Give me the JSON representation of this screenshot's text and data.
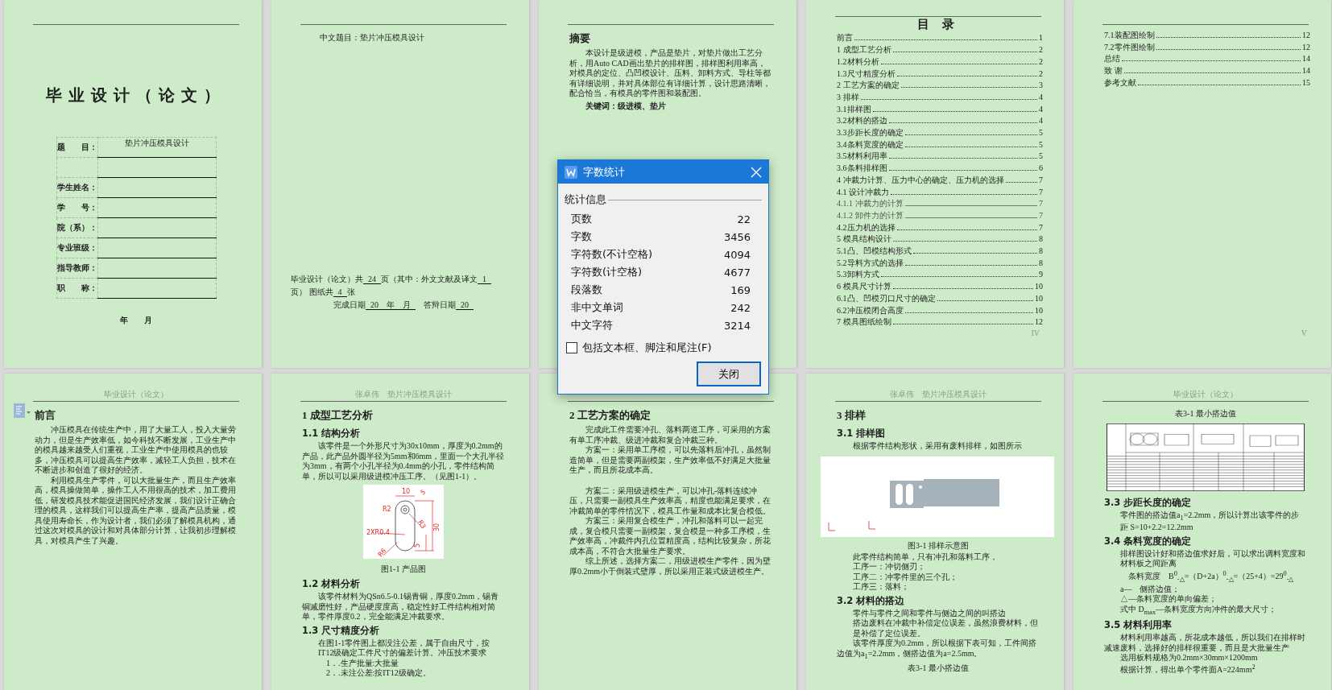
{
  "cover": {
    "title": "毕业设计（论文）",
    "fields": [
      {
        "kind": "field",
        "label": "题　　目：",
        "value": "垫片冲压模具设计"
      },
      {
        "kind": "extra_line"
      },
      {
        "kind": "field",
        "label": "学生姓名："
      },
      {
        "kind": "field",
        "label": "学　　号："
      },
      {
        "kind": "field",
        "label": "院（系）："
      },
      {
        "kind": "field",
        "label": "专业班级："
      },
      {
        "kind": "field",
        "label": "指导教师："
      },
      {
        "kind": "field",
        "label": "职　　称："
      }
    ],
    "date": "年　　月"
  },
  "info_page": {
    "title": "中文题目：垫片冲压模具设计",
    "statement": [
      {
        "kind": "text",
        "text": "毕业设计（论文）共"
      },
      {
        "kind": "blank",
        "text": "24"
      },
      {
        "kind": "text",
        "text": "页（其中：外文文献及译文"
      },
      {
        "kind": "blank",
        "text": "1"
      },
      {
        "kind": "text",
        "text": "页） 图纸共"
      },
      {
        "kind": "blank",
        "text": "4"
      },
      {
        "kind": "text",
        "text": "张"
      }
    ],
    "dates": [
      {
        "kind": "text",
        "text": "完成日期"
      },
      {
        "kind": "blank",
        "text": "20　年　月"
      },
      {
        "kind": "text",
        "text": "　答辩日期"
      },
      {
        "kind": "blank",
        "text": "20"
      }
    ]
  },
  "abstract_page": {
    "blocks": [
      {
        "kind": "title",
        "text": "摘要"
      },
      {
        "kind": "paragraph",
        "text": "本设计是级进模，产品是垫片，对垫片做出工艺分析，用Auto CAD画出垫片的排样图，排样图利用率高，对模具的定位、凸凹模设计、压料、卸料方式、导柱等都有详细说明，并对具体部位有详细计算，设计思路清晰，配合恰当，有模具的零件图和装配图。"
      },
      {
        "kind": "keywords",
        "text": "关键词：级进模、垫片"
      }
    ]
  },
  "toc_pages": [
    {
      "title": "目 录",
      "footer": "IV",
      "entries": [
        {
          "text": "前言",
          "page": "1",
          "kind": "major"
        },
        {
          "text": "1 成型工艺分析",
          "page": "2",
          "kind": "major"
        },
        {
          "text": "1.2材料分析",
          "page": "2",
          "kind": "major"
        },
        {
          "text": "1.3尺寸精度分析",
          "page": "2",
          "kind": "major"
        },
        {
          "text": "2 工艺方案的确定",
          "page": "3",
          "kind": "major"
        },
        {
          "text": "3  排样",
          "page": "4",
          "kind": "major"
        },
        {
          "text": "3.1排样图",
          "page": "4",
          "kind": "major"
        },
        {
          "text": "3.2材料的搭边",
          "page": "4",
          "kind": "major"
        },
        {
          "text": "3.3步距长度的确定",
          "page": "5",
          "kind": "major"
        },
        {
          "text": "3.4条料宽度的确定",
          "page": "5",
          "kind": "major"
        },
        {
          "text": "3.5材料利用率",
          "page": "5",
          "kind": "major"
        },
        {
          "text": "3.6条料排样图",
          "page": "6",
          "kind": "major"
        },
        {
          "text": "4 冲裁力计算、压力中心的确定、压力机的选择",
          "page": "7",
          "kind": "major"
        },
        {
          "text": "4.1  设计冲裁力",
          "page": "7",
          "kind": "major"
        },
        {
          "text": "4.1.1 冲裁力的计算",
          "page": "7",
          "kind": "minor"
        },
        {
          "text": "4.1.2 卸件力的计算",
          "page": "7",
          "kind": "minor"
        },
        {
          "text": "4.2压力机的选择",
          "page": "7",
          "kind": "major"
        },
        {
          "text": "5 模具结构设计",
          "page": "8",
          "kind": "major"
        },
        {
          "text": "5.1凸、凹模结构形式",
          "page": "8",
          "kind": "major"
        },
        {
          "text": "5.2导料方式的选择",
          "page": "8",
          "kind": "major"
        },
        {
          "text": "5.3卸料方式",
          "page": "9",
          "kind": "major"
        },
        {
          "text": "6 模具尺寸计算",
          "page": "10",
          "kind": "major"
        },
        {
          "text": "6.1凸、凹模刃口尺寸的确定",
          "page": "10",
          "kind": "major"
        },
        {
          "text": "6.2冲压模闭合高度",
          "page": "10",
          "kind": "major"
        },
        {
          "text": "7 模具图纸绘制",
          "page": "12",
          "kind": "major"
        }
      ]
    },
    {
      "footer": "V",
      "entries": [
        {
          "text": "7.1装配图绘制",
          "page": "12",
          "kind": "major"
        },
        {
          "text": "7.2零件图绘制",
          "page": "12",
          "kind": "major"
        },
        {
          "text": "总结",
          "page": "14",
          "kind": "major"
        },
        {
          "text": "致  谢",
          "page": "14",
          "kind": "major"
        },
        {
          "text": "参考文献",
          "page": "15",
          "kind": "major"
        }
      ]
    }
  ],
  "body_pages": [
    {
      "header": "毕业设计（论文）",
      "blocks": [
        {
          "kind": "title",
          "text": "前言"
        },
        {
          "kind": "paragraph",
          "text": "冲压模具在传统生产中，用了大量工人，投入大量劳动力，但是生产效率低，如今科技不断发展，工业生产中的模具越来越受人们重视，工业生产中使用模具的也较多，冲压模具可以提高生产效率，减轻工人负担，技术在不断进步和创造了很好的经济。"
        },
        {
          "kind": "paragraph",
          "text": "利用模具生产零件，可以大批量生产，而且生产效率高，模具操做简单，操作工人不用很高的技术，加工费用低，研发模具技术能促进国民经济发展，我们设计正确合理的模具，这样我们可以提高生产率，提高产品质量，模具使用寿命长，作为设计者，我们必须了解模具机构，通过这次对模具的设计和对具体部分计算，让我初步理解模具，对模具产生了兴趣。"
        }
      ]
    },
    {
      "header": "张卓伟　垫片冲压模具设计",
      "blocks": [
        {
          "kind": "title",
          "text": "1 成型工艺分析"
        },
        {
          "kind": "heading",
          "text": "1.1 结构分析"
        },
        {
          "kind": "paragraph",
          "text": "该零件是一个外形尺寸为30x10mm，厚度为0.2mm的产品，此产品外圆半径为5mm和6mm，里面一个大孔半径为3mm，有两个小孔半径为0.4mm的小孔，零件结构简单，所以可以采用级进模冲压工序。（见图1-1）。"
        },
        {
          "kind": "product_figure",
          "labels": [
            "10",
            "5",
            "R2",
            "R3",
            "30",
            "2XR0.4",
            "5",
            "R6"
          ]
        },
        {
          "kind": "caption",
          "text": "图1-1 产品图"
        },
        {
          "kind": "heading",
          "text": "1.2 材料分析"
        },
        {
          "kind": "paragraph",
          "text": "该零件材料为QSn6.5-0.1锡青铜，厚度0.2mm，锡青铜减磨性好，产品硬度度高，稳定性好工件结构相对简单，零件厚度0.2，完全能满足冲裁要求。"
        },
        {
          "kind": "heading",
          "text": "1.3 尺寸精度分析"
        },
        {
          "kind": "line",
          "text": "在图1-1零件图上都没注公差，属于自由尺寸，按IT12级确定工件尺寸的偏差计算。冲压技术要求"
        },
        {
          "kind": "item",
          "text": "1．.生产批量:大批量"
        },
        {
          "kind": "item",
          "text": "2．.未注公差:按IT12级确定。"
        }
      ]
    },
    {
      "blocks": [
        {
          "kind": "title",
          "text": "2 工艺方案的确定"
        },
        {
          "kind": "paragraph",
          "text": "完成此工件需要冲孔、落料两道工序，可采用的方案有单工序冲裁、级进冲裁和复合冲裁三种。"
        },
        {
          "kind": "paragraph",
          "text": "方案一：采用单工序模，可以先落料后冲孔，虽然制造简单，但是需要两副模架，生产效率低不好满足大批量生产，而且所花成本高。"
        },
        {
          "kind": "gap"
        },
        {
          "kind": "paragraph",
          "text": "方案二：采用级进模生产，可以冲孔-落料连续冲压，只需要一副模具生产效率高，精度也能满足要求，在冲裁简单的零件情况下，模具工作量和成本比复合模低。"
        },
        {
          "kind": "paragraph",
          "text": "方案三：采用复合模生产，冲孔和落料可以一起完成，复合模只需要一副模架，复合模是一种多工序模，生产效率高，冲裁件内孔位置精度高，结构比较复杂，所花成本高，不符合大批量生产要求。"
        },
        {
          "kind": "paragraph",
          "text": "综上所述，选择方案二，用级进模生产零件，因为壁厚0.2mm小于倒装式壁厚，所以采用正装式级进模生产。"
        }
      ]
    },
    {
      "header": "张卓伟　垫片冲压模具设计",
      "blocks": [
        {
          "kind": "title",
          "text": "3  排样"
        },
        {
          "kind": "heading",
          "text": "3.1 排样图"
        },
        {
          "kind": "line",
          "text": "根据零件结构形状，采用有废料排样，如图所示"
        },
        {
          "kind": "strip_figure"
        },
        {
          "kind": "caption",
          "text": "图3-1 排样示意图"
        },
        {
          "kind": "line",
          "text": "此零件结构简单，只有冲孔和落料工序，"
        },
        {
          "kind": "line",
          "text": "工序一：冲切侧刃；"
        },
        {
          "kind": "line",
          "text": "工序二：冲零件里的三个孔；"
        },
        {
          "kind": "line",
          "text": "工序三：落料；"
        },
        {
          "kind": "heading",
          "text": "3.2 材料的搭边"
        },
        {
          "kind": "line",
          "text": "零件与零件之间和零件与侧边之间的叫搭边"
        },
        {
          "kind": "line",
          "text": "搭边废料在冲裁中补偿定位误差，虽然浪费材料，但是补偿了定位误差。"
        },
        {
          "kind": "paragraph",
          "text": "该零件厚度为0.2mm，所以根据下表可知，工件间搭边值为a$_{1}$=2.2mm，侧搭边值为a=2.5mm。"
        },
        {
          "kind": "caption",
          "text": "表3-1 最小搭边值"
        }
      ]
    },
    {
      "header": "毕业设计（论文）",
      "blocks": [
        {
          "kind": "caption",
          "text": "表3-1 最小搭边值"
        },
        {
          "kind": "table_figure"
        },
        {
          "kind": "heading",
          "text": "3.3 步距长度的确定"
        },
        {
          "kind": "line",
          "text": "零件图的搭边值a$_{1}$=2.2mm，所以计算出该零件的步距 S=10+2.2=12.2mm"
        },
        {
          "kind": "heading",
          "text": "3.4 条料宽度的确定"
        },
        {
          "kind": "line",
          "text": "排样图设计好和搭边值求好后，可以求出调料宽度和材料板之间距离"
        },
        {
          "kind": "formula",
          "text": "条料宽度　B$^{0}$$_{-△}$=（D+2a）$^{0}$$_{-△}$=（25+4）=29$^{0}$$_{-△}$"
        },
        {
          "kind": "line",
          "text": "a—　侧搭边值；"
        },
        {
          "kind": "line",
          "text": "△—条料宽度的单向偏差；"
        },
        {
          "kind": "line",
          "text": "式中 D$_{max}$—条料宽度方向冲件的最大尺寸；"
        },
        {
          "kind": "heading",
          "text": "3.5 材料利用率"
        },
        {
          "kind": "paragraph",
          "text": "材料利用率越高，所花成本越低，所以我们在排样时减速废料，选择好的排样很重要，而且是大批量生产"
        },
        {
          "kind": "line",
          "text": "选用板料规格为0.2mm×30mm×1200mm"
        },
        {
          "kind": "line",
          "text": "根据计算，得出单个零件面A=224mm$^{2}$"
        }
      ]
    }
  ],
  "dialog": {
    "title": "字数统计",
    "section": "统计信息",
    "stats": [
      {
        "label": "页数",
        "value": "22"
      },
      {
        "label": "字数",
        "value": "3456"
      },
      {
        "label": "字符数(不计空格)",
        "value": "4094"
      },
      {
        "label": "字符数(计空格)",
        "value": "4677"
      },
      {
        "label": "段落数",
        "value": "169"
      },
      {
        "label": "非中文单词",
        "value": "242"
      },
      {
        "label": "中文字符",
        "value": "3214"
      }
    ],
    "include_notes": {
      "label": "包括文本框、脚注和尾注(F)",
      "checked": false
    },
    "close_button": "关闭"
  }
}
